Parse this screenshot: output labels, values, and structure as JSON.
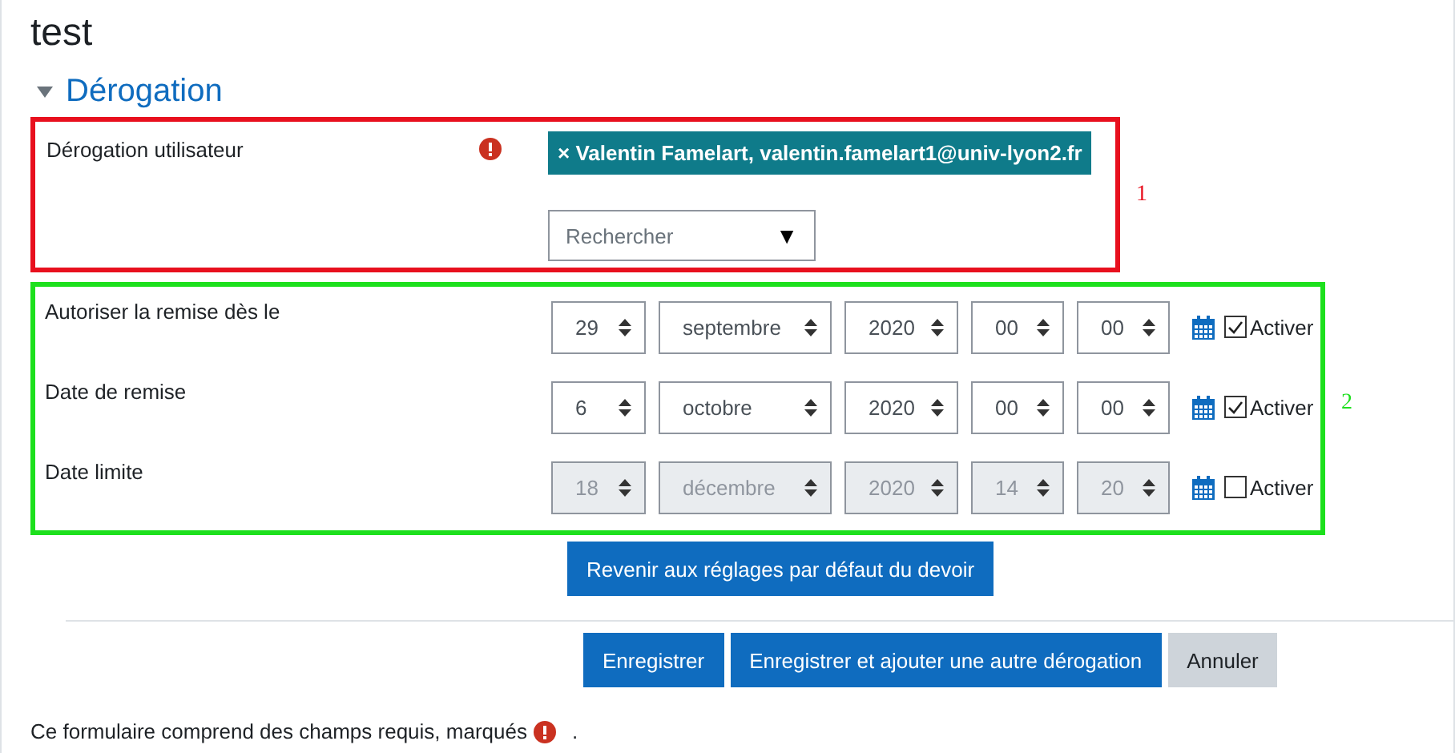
{
  "title": "test",
  "section": {
    "title": "Dérogation",
    "expanded": true
  },
  "user_override": {
    "label": "Dérogation utilisateur",
    "required": true,
    "selected_users": [
      {
        "remove": "×",
        "label": "Valentin Famelart, valentin.famelart1@univ-lyon2.fr"
      }
    ],
    "search": {
      "placeholder": "Rechercher",
      "caret": "▼"
    },
    "annotation": "1"
  },
  "dates": {
    "annotation": "2",
    "rows": [
      {
        "label": "Autoriser la remise dès le",
        "fields": [
          "29",
          "septembre",
          "2020",
          "00",
          "00"
        ],
        "enabled": true,
        "checkbox_label": "Activer"
      },
      {
        "label": "Date de remise",
        "fields": [
          "6",
          "octobre",
          "2020",
          "00",
          "00"
        ],
        "enabled": true,
        "checkbox_label": "Activer"
      },
      {
        "label": "Date limite",
        "fields": [
          "18",
          "décembre",
          "2020",
          "14",
          "20"
        ],
        "enabled": false,
        "checkbox_label": "Activer"
      }
    ]
  },
  "revert_button": "Revenir aux réglages par défaut du devoir",
  "buttons": [
    {
      "label": "Enregistrer",
      "kind": "primary"
    },
    {
      "label": "Enregistrer et ajouter une autre dérogation",
      "kind": "primary"
    },
    {
      "label": "Annuler",
      "kind": "secondary"
    }
  ],
  "footer": {
    "text": "Ce formulaire comprend des champs requis, marqués",
    "end": "."
  }
}
